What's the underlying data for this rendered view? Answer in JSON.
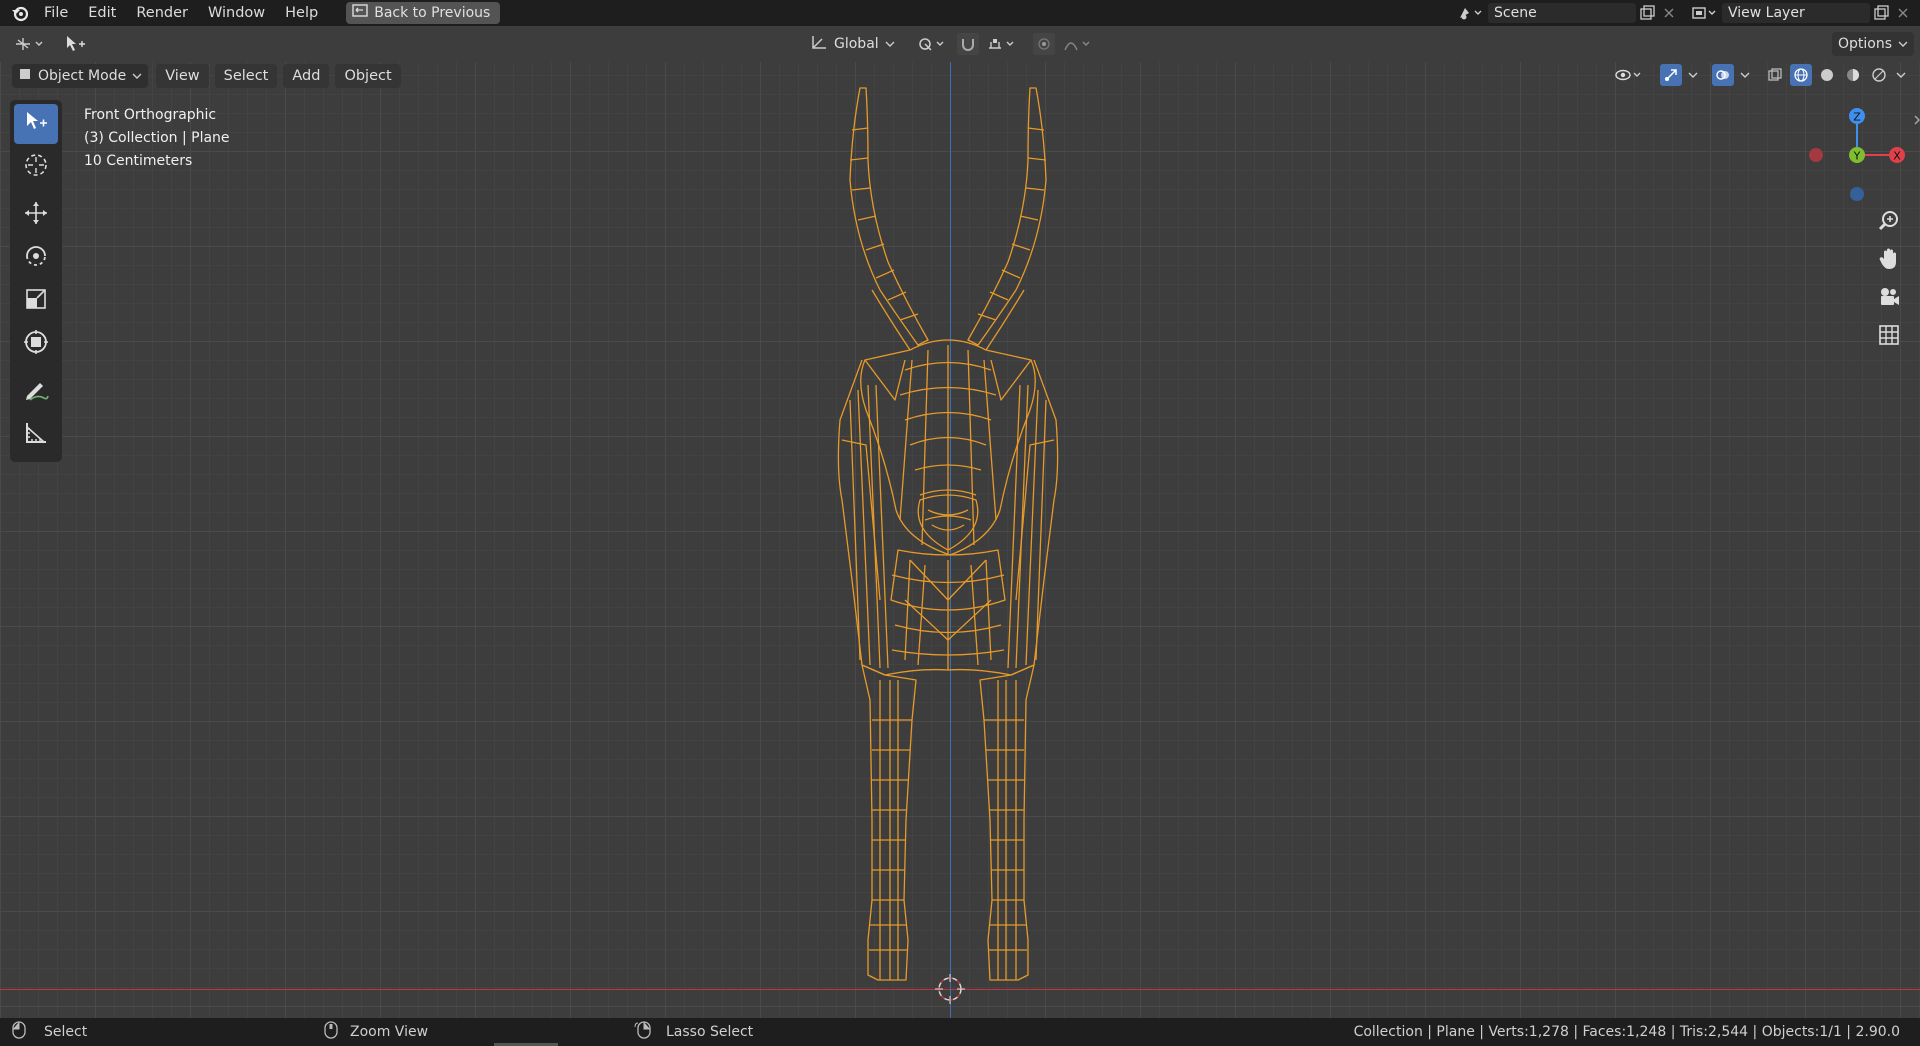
{
  "topbar": {
    "menus": [
      "File",
      "Edit",
      "Render",
      "Window",
      "Help"
    ],
    "back_label": "Back to Previous",
    "scene_name": "Scene",
    "view_layer": "View Layer"
  },
  "header": {
    "transform_orientation": "Global",
    "options_label": "Options"
  },
  "viewport_header": {
    "mode": "Object Mode",
    "menus": [
      "View",
      "Select",
      "Add",
      "Object"
    ]
  },
  "overlay": {
    "view_name": "Front Orthographic",
    "collection_info": "(3) Collection | Plane",
    "scale": "10 Centimeters"
  },
  "gizmo": {
    "z_label": "Z",
    "y_label": "Y",
    "x_label": "X",
    "colors": {
      "x": "#e0404a",
      "y": "#7fbf2f",
      "z": "#3f8ff0"
    }
  },
  "statusbar": {
    "select": "Select",
    "zoom": "Zoom View",
    "lasso": "Lasso Select",
    "stats": "Collection | Plane | Verts:1,278 | Faces:1,248 | Tris:2,544 | Objects:1/1 | 2.90.0"
  },
  "colors": {
    "mesh_wire": "#e69a2a",
    "accent": "#4772b3"
  }
}
